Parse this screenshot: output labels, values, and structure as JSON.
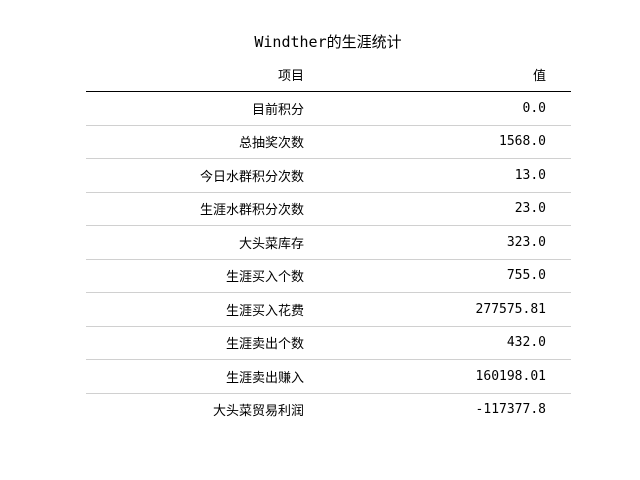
{
  "title": "Windther的生涯统计",
  "table": {
    "columns": [
      "项目",
      "值"
    ],
    "rows": [
      {
        "item": "目前积分",
        "value": "0.0"
      },
      {
        "item": "总抽奖次数",
        "value": "1568.0"
      },
      {
        "item": "今日水群积分次数",
        "value": "13.0"
      },
      {
        "item": "生涯水群积分次数",
        "value": "23.0"
      },
      {
        "item": "大头菜库存",
        "value": "323.0"
      },
      {
        "item": "生涯买入个数",
        "value": "755.0"
      },
      {
        "item": "生涯买入花费",
        "value": "277575.81"
      },
      {
        "item": "生涯卖出个数",
        "value": "432.0"
      },
      {
        "item": "生涯卖出赚入",
        "value": "160198.01"
      },
      {
        "item": "大头菜贸易利润",
        "value": "-117377.8"
      }
    ]
  }
}
